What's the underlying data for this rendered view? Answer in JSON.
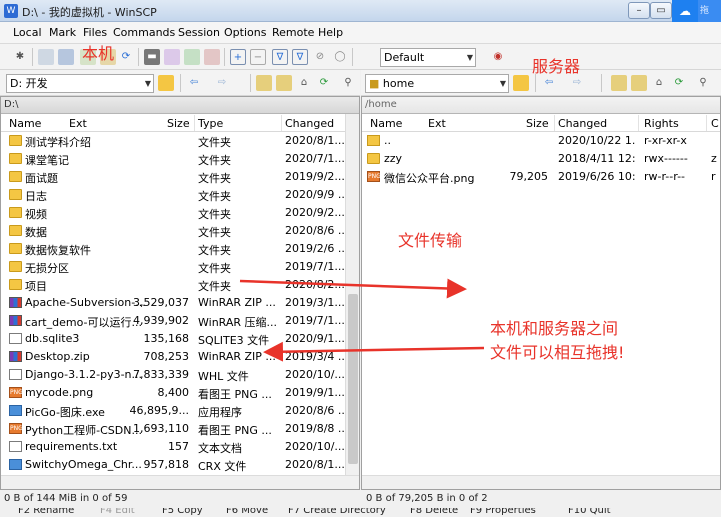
{
  "window": {
    "title": "D:\\ - 我的虚拟机 - WinSCP",
    "min_label": "▭",
    "max_label": "▭",
    "extra_tab": "拖"
  },
  "menu": {
    "items": [
      "Local",
      "Mark",
      "Files",
      "Commands",
      "Session",
      "Options",
      "Remote",
      "Help"
    ]
  },
  "toolbar": {
    "profile": "Default"
  },
  "local": {
    "drive": "D: 开发",
    "path": "D:\\",
    "columns": {
      "name": "Name",
      "ext": "Ext",
      "size": "Size",
      "type": "Type",
      "changed": "Changed"
    },
    "rows": [
      {
        "icon": "folder",
        "name": "测试学科介绍",
        "size": "",
        "type": "文件夹",
        "changed": "2020/8/1..."
      },
      {
        "icon": "folder",
        "name": "课堂笔记",
        "size": "",
        "type": "文件夹",
        "changed": "2020/7/1..."
      },
      {
        "icon": "folder",
        "name": "面试题",
        "size": "",
        "type": "文件夹",
        "changed": "2019/9/2..."
      },
      {
        "icon": "folder",
        "name": "日志",
        "size": "",
        "type": "文件夹",
        "changed": "2020/9/9 ..."
      },
      {
        "icon": "folder",
        "name": "视频",
        "size": "",
        "type": "文件夹",
        "changed": "2020/9/2..."
      },
      {
        "icon": "folder",
        "name": "数据",
        "size": "",
        "type": "文件夹",
        "changed": "2020/8/6 ..."
      },
      {
        "icon": "folder",
        "name": "数据恢复软件",
        "size": "",
        "type": "文件夹",
        "changed": "2019/2/6 ..."
      },
      {
        "icon": "folder",
        "name": "无损分区",
        "size": "",
        "type": "文件夹",
        "changed": "2019/7/1..."
      },
      {
        "icon": "folder",
        "name": "项目",
        "size": "",
        "type": "文件夹",
        "changed": "2020/8/2..."
      },
      {
        "icon": "rar",
        "name": "Apache-Subversion-...",
        "size": "3,529,037",
        "type": "WinRAR ZIP ...",
        "changed": "2019/3/1..."
      },
      {
        "icon": "rar",
        "name": "cart_demo-可以运行...",
        "size": "4,939,902",
        "type": "WinRAR 压缩...",
        "changed": "2019/7/1..."
      },
      {
        "icon": "txt",
        "name": "db.sqlite3",
        "size": "135,168",
        "type": "SQLITE3 文件",
        "changed": "2020/9/1..."
      },
      {
        "icon": "rar",
        "name": "Desktop.zip",
        "size": "708,253",
        "type": "WinRAR ZIP ...",
        "changed": "2019/3/4 ..."
      },
      {
        "icon": "txt",
        "name": "Django-3.1.2-py3-n...",
        "size": "7,833,339",
        "type": "WHL 文件",
        "changed": "2020/10/..."
      },
      {
        "icon": "png",
        "name": "mycode.png",
        "size": "8,400",
        "type": "看图王 PNG ...",
        "changed": "2019/9/1..."
      },
      {
        "icon": "exe",
        "name": "PicGo-图床.exe",
        "size": "46,895,9...",
        "type": "应用程序",
        "changed": "2020/8/6 ..."
      },
      {
        "icon": "png",
        "name": "Python工程师-CSDN...",
        "size": "1,693,110",
        "type": "看图王 PNG ...",
        "changed": "2019/8/8 ..."
      },
      {
        "icon": "txt",
        "name": "requirements.txt",
        "size": "157",
        "type": "文本文档",
        "changed": "2020/10/..."
      },
      {
        "icon": "exe",
        "name": "SwitchyOmega_Chr...",
        "size": "957,818",
        "type": "CRX 文件",
        "changed": "2020/8/1..."
      }
    ],
    "status": "0 B of 144 MiB in 0 of 59"
  },
  "remote": {
    "folder": "home",
    "path": "/home",
    "columns": {
      "name": "Name",
      "ext": "Ext",
      "size": "Size",
      "changed": "Changed",
      "rights": "Rights",
      "owner": "C"
    },
    "rows": [
      {
        "icon": "up",
        "name": "..",
        "size": "",
        "changed": "2020/10/22 1...",
        "rights": "r-xr-xr-x"
      },
      {
        "icon": "folder",
        "name": "zzy",
        "size": "",
        "changed": "2018/4/11 12:...",
        "rights": "rwx------",
        "owner": "z"
      },
      {
        "icon": "png",
        "name": "微信公众平台.png",
        "size": "79,205",
        "changed": "2019/6/26 10:...",
        "rights": "rw-r--r--",
        "owner": "r"
      }
    ],
    "status": "0 B of 79,205 B in 0 of 2"
  },
  "fkeys": [
    "F2 Rename",
    "F4 Edit",
    "F5 Copy",
    "F6 Move",
    "F7 Create Directory",
    "F8 Delete",
    "F9 Properties",
    "F10 Quit"
  ],
  "annotations": {
    "local": "本机",
    "server": "服务器",
    "transfer": "文件传输",
    "drag_line1": "本机和服务器之间",
    "drag_line2": "文件可以相互拖拽!"
  },
  "colors": {
    "annotation": "#e8332a",
    "folder": "#f4c643",
    "titlebar": "#c4d6ec"
  }
}
